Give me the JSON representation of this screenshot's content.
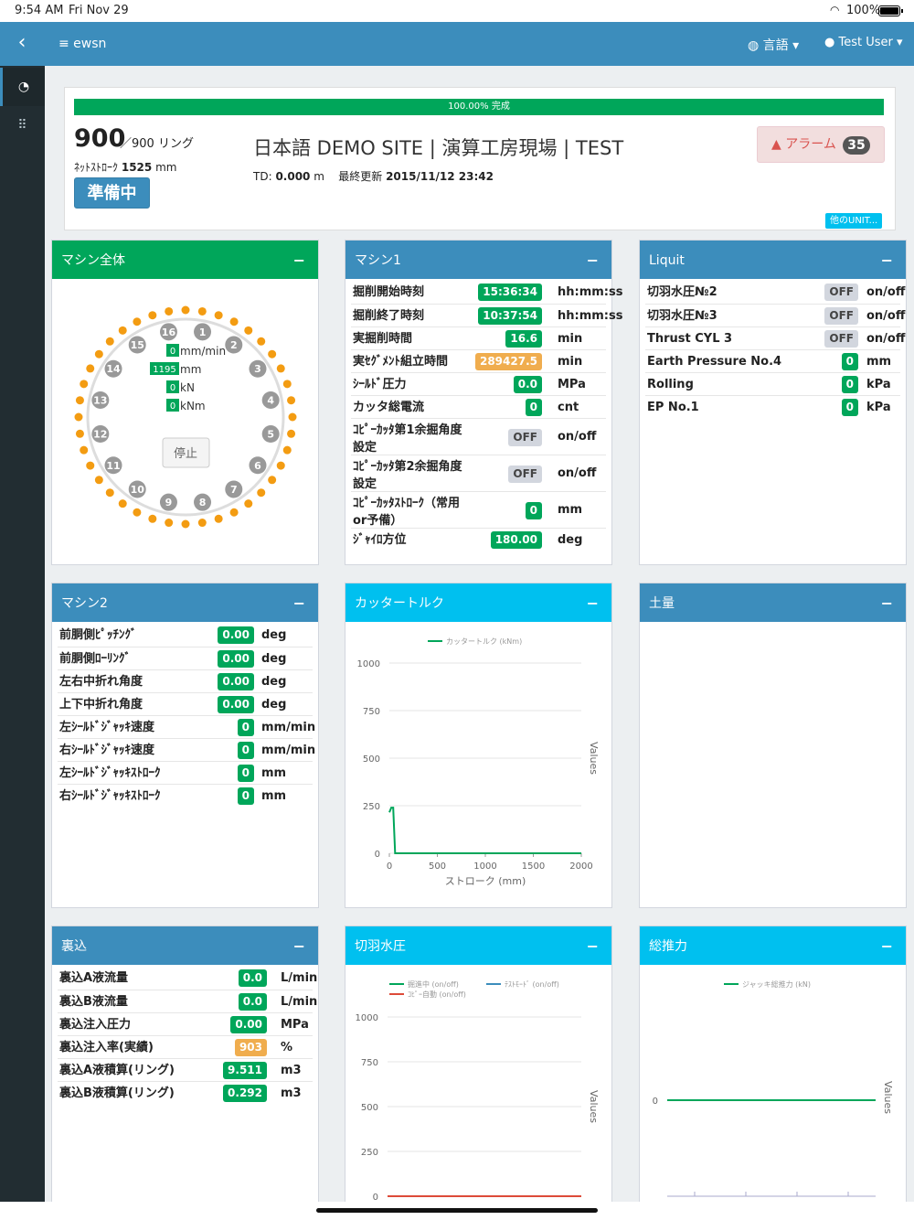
{
  "status": {
    "time": "9:54 AM",
    "date": "Fri Nov 29",
    "battery": "100%"
  },
  "nav": {
    "back_icon": "chevron-left-icon",
    "brand": "≡ ewsn",
    "lang": "言語 ▾",
    "user": "Test User ▾"
  },
  "sidebar": {
    "items": [
      {
        "icon": "dashboard-icon",
        "glyph": "◔",
        "active": true
      },
      {
        "icon": "grid-icon",
        "glyph": "⠿",
        "active": false
      }
    ]
  },
  "info": {
    "progress_label": "100.00% 完成",
    "progress_pct": 100,
    "ring_current": "900",
    "ring_suffix": "／900 リング",
    "net_stroke_label": "ﾈｯﾄｽﾄﾛｰｸ",
    "net_stroke_value": "1525",
    "net_stroke_unit": "mm",
    "status_button": "準備中",
    "site_name": "日本語 DEMO SITE | 演算工房現場 | TEST",
    "td_label": "TD:",
    "td_value": "0.000",
    "td_unit": "m",
    "last_update_label": "最終更新",
    "last_update_value": "2015/11/12 23:42",
    "alarm_label": "アラーム",
    "alarm_count": "35",
    "other_unit": "他のUNIT..."
  },
  "machine_all": {
    "title": "マシン全体",
    "jacks": [
      "1",
      "2",
      "3",
      "4",
      "5",
      "6",
      "7",
      "8",
      "9",
      "10",
      "11",
      "12",
      "13",
      "14",
      "15",
      "16"
    ],
    "readouts": [
      {
        "value": "0",
        "unit": "mm/min"
      },
      {
        "value": "1195",
        "unit": "mm"
      },
      {
        "value": "0",
        "unit": "kN"
      },
      {
        "value": "0",
        "unit": "kNm"
      }
    ],
    "stop_button": "停止"
  },
  "machine1": {
    "title": "マシン1",
    "rows": [
      {
        "label": "掘削開始時刻",
        "value": "15:36:34",
        "unit": "hh:mm:ss",
        "style": "green"
      },
      {
        "label": "掘削終了時刻",
        "value": "10:37:54",
        "unit": "hh:mm:ss",
        "style": "green"
      },
      {
        "label": "実掘削時間",
        "value": "16.6",
        "unit": "min",
        "style": "green"
      },
      {
        "label": "実ｾｸﾞﾒﾝﾄ組立時間",
        "value": "289427.5",
        "unit": "min",
        "style": "orange"
      },
      {
        "label": "ｼｰﾙﾄﾞ圧力",
        "value": "0.0",
        "unit": "MPa",
        "style": "green"
      },
      {
        "label": "カッタ総電流",
        "value": "0",
        "unit": "cnt",
        "style": "green"
      },
      {
        "label": "ｺﾋﾟｰｶｯﾀ第1余掘角度",
        "label2": "設定",
        "value": "OFF",
        "unit": "on/off",
        "style": "gray"
      },
      {
        "label": "ｺﾋﾟｰｶｯﾀ第2余掘角度",
        "label2": "設定",
        "value": "OFF",
        "unit": "on/off",
        "style": "gray"
      },
      {
        "label": "ｺﾋﾟｰｶｯﾀｽﾄﾛｰｸ（常用",
        "label2": "or予備）",
        "value": "0",
        "unit": "mm",
        "style": "green"
      },
      {
        "label": "ｼﾞｬｲﾛ方位",
        "value": "180.00",
        "unit": "deg",
        "style": "green"
      }
    ]
  },
  "liquit": {
    "title": "Liquit",
    "rows": [
      {
        "label": "切羽水圧№2",
        "value": "OFF",
        "unit": "on/off",
        "style": "gray"
      },
      {
        "label": "切羽水圧№3",
        "value": "OFF",
        "unit": "on/off",
        "style": "gray"
      },
      {
        "label": "Thrust CYL 3",
        "value": "OFF",
        "unit": "on/off",
        "style": "gray"
      },
      {
        "label": "Earth Pressure    No.4",
        "value": "0",
        "unit": "mm",
        "style": "green"
      },
      {
        "label": "Rolling",
        "value": "0",
        "unit": "kPa",
        "style": "green"
      },
      {
        "label": "EP No.1",
        "value": "0",
        "unit": "kPa",
        "style": "green"
      }
    ]
  },
  "machine2": {
    "title": "マシン2",
    "rows": [
      {
        "label": "前胴側ﾋﾟｯﾁﾝｸﾞ",
        "value": "0.00",
        "unit": "deg",
        "style": "green"
      },
      {
        "label": "前胴側ﾛｰﾘﾝｸﾞ",
        "value": "0.00",
        "unit": "deg",
        "style": "green"
      },
      {
        "label": "左右中折れ角度",
        "value": "0.00",
        "unit": "deg",
        "style": "green"
      },
      {
        "label": "上下中折れ角度",
        "value": "0.00",
        "unit": "deg",
        "style": "green"
      },
      {
        "label": "左ｼｰﾙﾄﾞｼﾞｬｯｷ速度",
        "value": "0",
        "unit": "mm/min",
        "style": "green"
      },
      {
        "label": "右ｼｰﾙﾄﾞｼﾞｬｯｷ速度",
        "value": "0",
        "unit": "mm/min",
        "style": "green"
      },
      {
        "label": "左ｼｰﾙﾄﾞｼﾞｬｯｷｽﾄﾛｰｸ",
        "value": "0",
        "unit": "mm",
        "style": "green"
      },
      {
        "label": "右ｼｰﾙﾄﾞｼﾞｬｯｷｽﾄﾛｰｸ",
        "value": "0",
        "unit": "mm",
        "style": "green"
      }
    ]
  },
  "urakomi": {
    "title": "裏込",
    "rows": [
      {
        "label": "裏込A液流量",
        "value": "0.0",
        "unit": "L/min",
        "style": "green"
      },
      {
        "label": "裏込B液流量",
        "value": "0.0",
        "unit": "L/min",
        "style": "green"
      },
      {
        "label": "裏込注入圧力",
        "value": "0.00",
        "unit": "MPa",
        "style": "green"
      },
      {
        "label": "裏込注入率(実績)",
        "value": "903",
        "unit": "%",
        "style": "orange"
      },
      {
        "label": "裏込A液積算(リング)",
        "value": "9.511",
        "unit": "m3",
        "style": "green"
      },
      {
        "label": "裏込B液積算(リング)",
        "value": "0.292",
        "unit": "m3",
        "style": "green"
      }
    ]
  },
  "doryo": {
    "title": "土量"
  },
  "chart_data": [
    {
      "type": "line",
      "panel_title": "カッタートルク",
      "series": [
        {
          "name": "カッタートルク (kNm)",
          "color": "#00a65a",
          "x": [
            0,
            20,
            40,
            60,
            2000
          ],
          "y": [
            215,
            240,
            240,
            0,
            0
          ]
        }
      ],
      "xlabel": "ストローク (mm)",
      "ylabel": "Values",
      "xticks": [
        "0",
        "500",
        "1000",
        "1500",
        "2000"
      ],
      "yticks": [
        "0",
        "250",
        "500",
        "750",
        "1000"
      ],
      "xlim": [
        0,
        2000
      ],
      "ylim": [
        0,
        1000
      ],
      "grid": true,
      "legend": "top"
    },
    {
      "type": "line",
      "panel_title": "切羽水圧",
      "series": [
        {
          "name": "掘進中 (on/off)",
          "color": "#00a65a",
          "x": [
            0,
            1
          ],
          "y": [
            0,
            0
          ]
        },
        {
          "name": "ﾃｽﾄﾓｰﾄﾞ (on/off)",
          "color": "#3c8dbc",
          "x": [
            0,
            1
          ],
          "y": [
            0,
            0
          ]
        },
        {
          "name": "ｺﾋﾟｰ自動 (on/off)",
          "color": "#dd4b39",
          "x": [
            0,
            1
          ],
          "y": [
            0,
            0
          ]
        }
      ],
      "ylabel": "Values",
      "yticks": [
        "0",
        "250",
        "500",
        "750",
        "1000"
      ],
      "ylim": [
        0,
        1000
      ],
      "grid": true,
      "legend": "top"
    },
    {
      "type": "line",
      "panel_title": "総推力",
      "series": [
        {
          "name": "ジャッキ総推力 (kN)",
          "color": "#00a65a",
          "x": [
            0,
            1
          ],
          "y": [
            0,
            0
          ]
        }
      ],
      "ylabel": "Values",
      "yticks": [
        "0"
      ],
      "grid": true,
      "legend": "top"
    }
  ]
}
